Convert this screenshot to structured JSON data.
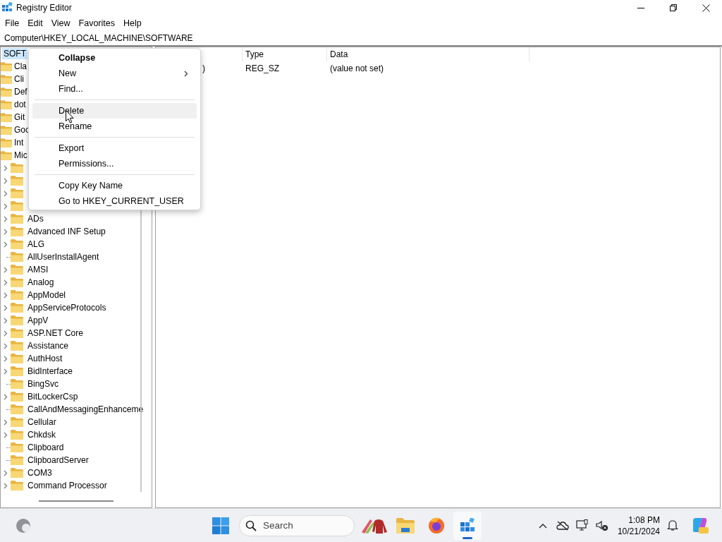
{
  "window": {
    "title": "Registry Editor"
  },
  "menu_bar": [
    "File",
    "Edit",
    "View",
    "Favorites",
    "Help"
  ],
  "address": "Computer\\HKEY_LOCAL_MACHINE\\SOFTWARE",
  "tree": {
    "label": "SOFT",
    "selected": true,
    "children": [
      {
        "label": "Cla"
      },
      {
        "label": "Cli"
      },
      {
        "label": "Def"
      },
      {
        "label": "dot"
      },
      {
        "label": "Git"
      },
      {
        "label": "Goo"
      },
      {
        "label": "Int"
      },
      {
        "label": "Mic",
        "children": [
          {
            "expandable": true
          },
          {
            "expandable": true
          },
          {
            "expandable": true
          },
          {
            "expandable": true
          },
          {
            "label": "ADs",
            "expandable": true
          },
          {
            "label": "Advanced INF Setup",
            "expandable": true
          },
          {
            "label": "ALG",
            "expandable": true
          },
          {
            "label": "AllUserInstallAgent",
            "expandable": false
          },
          {
            "label": "AMSI",
            "expandable": true
          },
          {
            "label": "Analog",
            "expandable": true
          },
          {
            "label": "AppModel",
            "expandable": true
          },
          {
            "label": "AppServiceProtocols",
            "expandable": true
          },
          {
            "label": "AppV",
            "expandable": true
          },
          {
            "label": "ASP.NET Core",
            "expandable": true
          },
          {
            "label": "Assistance",
            "expandable": true
          },
          {
            "label": "AuthHost",
            "expandable": true
          },
          {
            "label": "BidInterface",
            "expandable": true
          },
          {
            "label": "BingSvc",
            "expandable": false
          },
          {
            "label": "BitLockerCsp",
            "expandable": true
          },
          {
            "label": "CallAndMessagingEnhanceme",
            "expandable": false
          },
          {
            "label": "Cellular",
            "expandable": true
          },
          {
            "label": "Chkdsk",
            "expandable": true
          },
          {
            "label": "Clipboard",
            "expandable": false
          },
          {
            "label": "ClipboardServer",
            "expandable": false
          },
          {
            "label": "COM3",
            "expandable": true
          },
          {
            "label": "Command Processor",
            "expandable": true
          }
        ]
      }
    ]
  },
  "values": {
    "columns": [
      {
        "label": "Type"
      },
      {
        "label": "Data"
      }
    ],
    "rows": [
      {
        "name": ")",
        "type": "REG_SZ",
        "data": "(value not set)"
      }
    ]
  },
  "context_menu": {
    "items": [
      {
        "kind": "item",
        "label": "Collapse",
        "bold": true,
        "submenu": false,
        "selected": false
      },
      {
        "kind": "item",
        "label": "New",
        "bold": false,
        "submenu": true,
        "selected": false
      },
      {
        "kind": "item",
        "label": "Find...",
        "bold": false,
        "submenu": false,
        "selected": false
      },
      {
        "kind": "separator"
      },
      {
        "kind": "item",
        "label": "Delete",
        "bold": false,
        "submenu": false,
        "selected": true
      },
      {
        "kind": "item",
        "label": "Rename",
        "bold": false,
        "submenu": false,
        "selected": false
      },
      {
        "kind": "separator"
      },
      {
        "kind": "item",
        "label": "Export",
        "bold": false,
        "submenu": false,
        "selected": false
      },
      {
        "kind": "item",
        "label": "Permissions...",
        "bold": false,
        "submenu": false,
        "selected": false
      },
      {
        "kind": "separator"
      },
      {
        "kind": "item",
        "label": "Copy Key Name",
        "bold": false,
        "submenu": false,
        "selected": false
      },
      {
        "kind": "item",
        "label": "Go to HKEY_CURRENT_USER",
        "bold": false,
        "submenu": false,
        "selected": false
      }
    ]
  },
  "taskbar": {
    "search": {
      "placeholder": "Search"
    },
    "apps": [
      {
        "active": false
      },
      {
        "active": false
      },
      {
        "active": false
      },
      {
        "active": true
      }
    ],
    "time": "1:08 PM",
    "date": "10/21/2024"
  }
}
